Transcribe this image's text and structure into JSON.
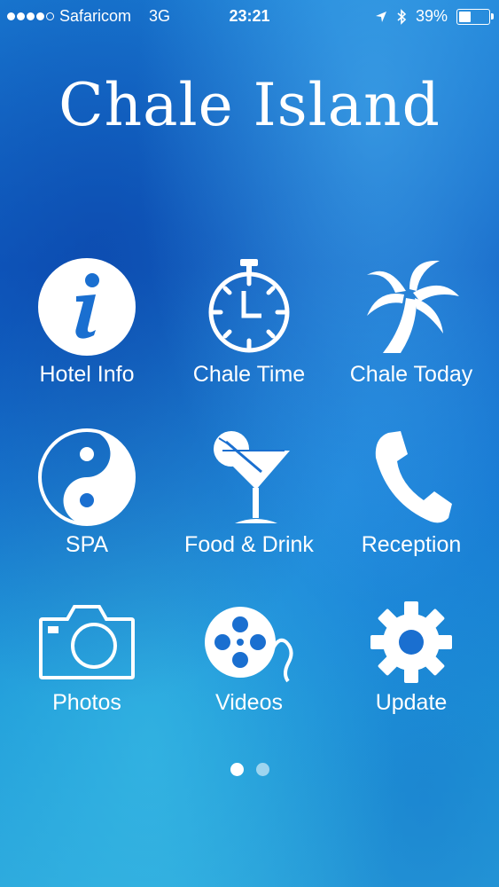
{
  "status_bar": {
    "carrier": "Safaricom",
    "network": "3G",
    "time": "23:21",
    "battery_percent": "39%",
    "battery_level": 0.39,
    "signal_bars_filled": 4,
    "signal_bars_total": 5
  },
  "app": {
    "title": "Chale Island"
  },
  "menu": {
    "items": [
      {
        "label": "Hotel Info",
        "icon": "info-icon"
      },
      {
        "label": "Chale Time",
        "icon": "stopwatch-icon"
      },
      {
        "label": "Chale Today",
        "icon": "palm-tree-icon"
      },
      {
        "label": "SPA",
        "icon": "yin-yang-icon"
      },
      {
        "label": "Food & Drink",
        "icon": "cocktail-icon"
      },
      {
        "label": "Reception",
        "icon": "phone-icon"
      },
      {
        "label": "Photos",
        "icon": "camera-icon"
      },
      {
        "label": "Videos",
        "icon": "film-reel-icon"
      },
      {
        "label": "Update",
        "icon": "gear-icon"
      }
    ]
  },
  "pager": {
    "current_page": 1,
    "total_pages": 2
  },
  "colors": {
    "accent": "#ffffff",
    "ocean": "#1577d2"
  }
}
